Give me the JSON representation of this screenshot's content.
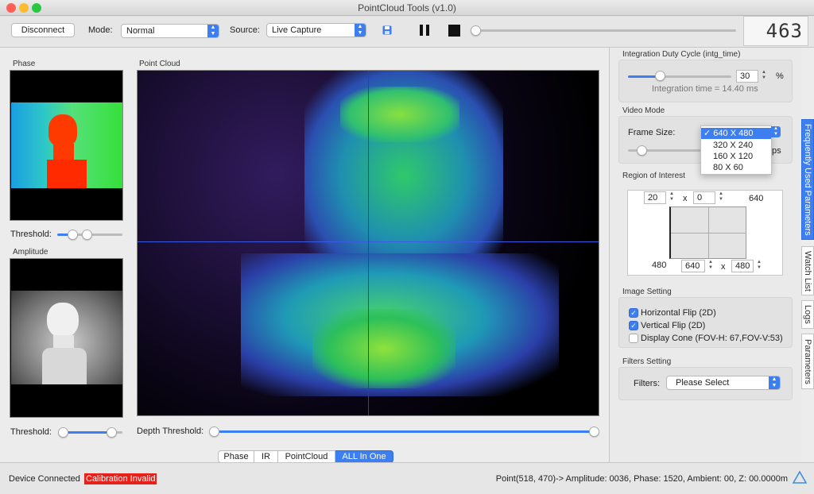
{
  "window": {
    "title": "PointCloud Tools (v1.0)"
  },
  "toolbar": {
    "disconnect_label": "Disconnect",
    "mode_label": "Mode:",
    "mode_value": "Normal",
    "source_label": "Source:",
    "source_value": "Live Capture",
    "counter": "463"
  },
  "left": {
    "phase_title": "Phase",
    "threshold_label": "Threshold:",
    "amplitude_title": "Amplitude",
    "threshold2_label": "Threshold:"
  },
  "center": {
    "pointcloud_title": "Point Cloud",
    "depth_threshold_label": "Depth Threshold:"
  },
  "tabs": [
    "Phase",
    "IR",
    "PointCloud",
    "ALL In One"
  ],
  "right": {
    "integration": {
      "title": "Integration Duty Cycle (intg_time)",
      "value": "30",
      "unit": "%",
      "note": "Integration time = 14.40 ms"
    },
    "video_mode": {
      "title": "Video Mode",
      "frame_size_label": "Frame Size:",
      "fps_suffix": "fps",
      "options": [
        "640 X 480",
        "320 X 240",
        "160 X 120",
        "80 X 60"
      ],
      "selected_mark": "✓"
    },
    "roi": {
      "title": "Region of Interest",
      "x": "20",
      "y": "0",
      "x_sep": "x",
      "max_w": "640",
      "max_h": "480",
      "w": "640",
      "h": "480"
    },
    "image_setting": {
      "title": "Image Setting",
      "hflip": "Horizontal Flip (2D)",
      "vflip": "Vertical Flip (2D)",
      "cone": "Display Cone (FOV-H: 67,FOV-V:53)"
    },
    "filters": {
      "title": "Filters Setting",
      "label": "Filters:",
      "value": "Please Select"
    }
  },
  "side_tabs": [
    "Frequently Used Parameters",
    "Watch List",
    "Logs",
    "Parameters"
  ],
  "status": {
    "connected": "Device Connected",
    "calibration": "Calibration Invalid",
    "point_info": "Point(518, 470)-> Amplitude: 0036, Phase: 1520, Ambient: 00, Z: 00.0000m"
  },
  "colors": {
    "accent": "#3d7ff0",
    "error": "#e8201a"
  }
}
